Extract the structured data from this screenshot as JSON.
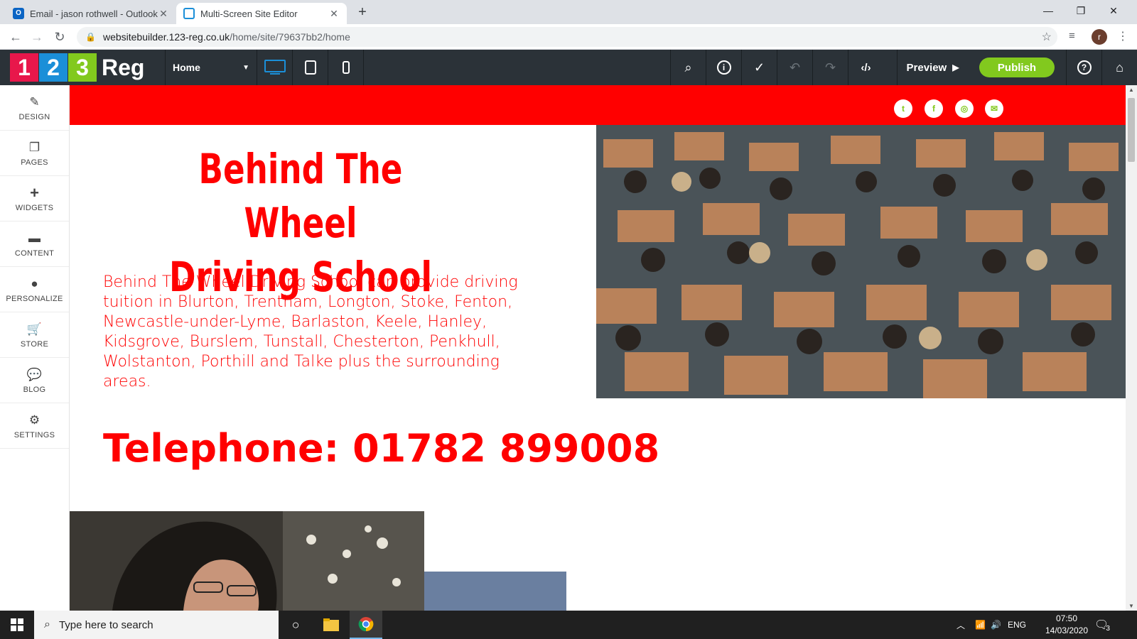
{
  "browser": {
    "tabs": [
      {
        "label": "Email - jason rothwell - Outlook",
        "active": false
      },
      {
        "label": "Multi-Screen Site Editor",
        "active": true
      }
    ],
    "url_host": "websitebuilder.123-reg.co.uk",
    "url_path": "/home/site/79637bb2/home",
    "profile_initial": "r"
  },
  "editor": {
    "logo": {
      "d1": "1",
      "d2": "2",
      "d3": "3",
      "text": "Reg",
      "colors": [
        "#e8174b",
        "#1b8fd8",
        "#82c91e"
      ]
    },
    "page_select": "Home",
    "preview_label": "Preview",
    "publish_label": "Publish",
    "accent": "#82c91e"
  },
  "sidebar": {
    "items": [
      {
        "label": "DESIGN",
        "icon": "brush-icon"
      },
      {
        "label": "PAGES",
        "icon": "pages-icon"
      },
      {
        "label": "WIDGETS",
        "icon": "plus-icon"
      },
      {
        "label": "CONTENT",
        "icon": "folder-icon"
      },
      {
        "label": "PERSONALIZE",
        "icon": "person-icon"
      },
      {
        "label": "STORE",
        "icon": "cart-icon"
      },
      {
        "label": "BLOG",
        "icon": "chat-icon"
      },
      {
        "label": "SETTINGS",
        "icon": "gear-icon"
      }
    ]
  },
  "site": {
    "brand_color": "#ff0000",
    "headline_line1": "Behind The Wheel",
    "headline_line2": "Driving School",
    "intro": "Behind The Wheel Driving School can provide driving tuition in Blurton, Trentham, Longton, Stoke, Fenton, Newcastle-under-Lyme, Barlaston, Keele, Hanley, Kidsgrove, Burslem, Tunstall, Chesterton, Penkhull, Wolstanton, Porthill and Talke plus the surrounding areas.",
    "phone": "Telephone: 01782 899008",
    "social_icons": [
      "twitter-icon",
      "facebook-icon",
      "instagram-icon",
      "email-icon"
    ]
  },
  "taskbar": {
    "search_placeholder": "Type here to search",
    "language": "ENG",
    "time": "07:50",
    "date": "14/03/2020",
    "notification_count": "3"
  }
}
